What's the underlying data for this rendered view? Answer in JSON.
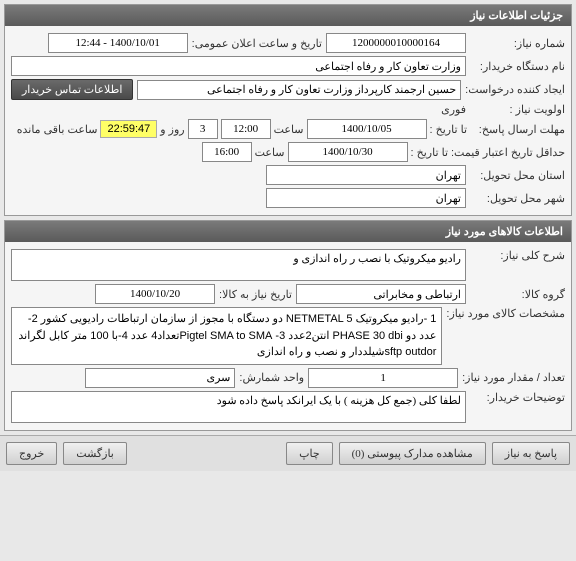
{
  "panel1": {
    "title": "جزئیات اطلاعات نیاز",
    "need_no_label": "شماره نیاز:",
    "need_no": "1200000010000164",
    "announce_label": "تاریخ و ساعت اعلان عمومی:",
    "announce_value": "1400/10/01 - 12:44",
    "buyer_label": "نام دستگاه خریدار:",
    "buyer_value": "وزارت تعاون کار و رفاه اجتماعی",
    "creator_label": "ایجاد کننده درخواست:",
    "creator_value": "حسین ارجمند کارپرداز وزارت تعاون کار و رفاه اجتماعی",
    "contact_btn": "اطلاعات تماس خریدار",
    "priority_label": "اولویت نیاز :",
    "priority_value": "فوری",
    "deadline_label": "مهلت ارسال پاسخ:",
    "to_date_label": "تا تاریخ :",
    "deadline_date": "1400/10/05",
    "time_label": "ساعت",
    "deadline_time": "12:00",
    "days_remain": "3",
    "days_and": "روز و",
    "countdown": "22:59:47",
    "remain_text": "ساعت باقی مانده",
    "min_valid_label": "حداقل تاریخ اعتبار قیمت:",
    "min_valid_date": "1400/10/30",
    "min_valid_time": "16:00",
    "province_label": "استان محل تحویل:",
    "province_value": "تهران",
    "city_label": "شهر محل تحویل:",
    "city_value": "تهران"
  },
  "panel2": {
    "title": "اطلاعات کالاهای مورد نیاز",
    "general_desc_label": "شرح کلی نیاز:",
    "general_desc_value": "رادیو میکروتیک با نصب ر راه اندازی و",
    "group_label": "گروه کالا:",
    "group_value": "ارتباطی و مخابراتی",
    "group_date_label": "تاریخ نیاز به کالا:",
    "group_date_value": "1400/10/20",
    "spec_label": "مشخصات کالای مورد نیاز:",
    "spec_value": "1 -رادیو میکروتیک NETMETAL 5 دو دستگاه با مجوز از سازمان ارتباطات رادیویی کشور 2-عدد دو PHASE 30 dbi انتن2عدد 3- Pigtel SMA to SMAتعداد4 عدد   4-با 100 متر کابل لگراند sftp  outdorشیلددار  و نصب و راه اندازی",
    "qty_label": "تعداد / مقدار مورد نیاز:",
    "qty_value": "1",
    "unit_label": "واحد شمارش:",
    "unit_value": "سری",
    "buyer_note_label": "توضیحات خریدار:",
    "buyer_note_value": "لطفا کلی (جمع کل هزینه ) با یک ایرانکد پاسخ داده شود"
  },
  "buttons": {
    "reply": "پاسخ به نیاز",
    "attachments": "مشاهده مدارک پیوستی (0)",
    "print": "چاپ",
    "back": "بازگشت",
    "exit": "خروج"
  }
}
